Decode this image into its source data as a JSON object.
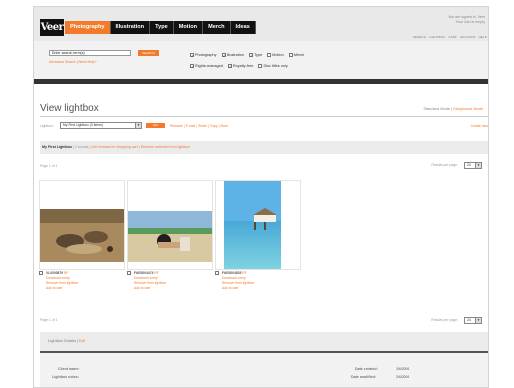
{
  "header": {
    "logo_text": "Veer",
    "tabs": [
      "Photography",
      "Illustration",
      "Type",
      "Motion",
      "Merch",
      "Ideas"
    ],
    "active_tab": "Photography",
    "signed_in": "You are signed in, Veer",
    "cart_status": "Your Cart is empty",
    "util_nav": [
      "SEARCH",
      "LIGHTBOX",
      "CART",
      "ACCOUNT",
      "HELP"
    ]
  },
  "search": {
    "value": "Enter search term(s)",
    "button": "SEARCH",
    "advanced": "Advanced Search",
    "need_help": "Need Help?",
    "filters_row1": [
      {
        "label": "Photography",
        "checked": true
      },
      {
        "label": "Illustration",
        "checked": true
      },
      {
        "label": "Type",
        "checked": true
      },
      {
        "label": "Motion",
        "checked": false
      },
      {
        "label": "Merch",
        "checked": false
      }
    ],
    "filters_row2": [
      {
        "label": "Rights-managed",
        "checked": true
      },
      {
        "label": "Royalty-free",
        "checked": true
      },
      {
        "label": "Disc titles only",
        "checked": false
      }
    ]
  },
  "page": {
    "title": "View lightbox",
    "mode_standard": "Standard Mode",
    "mode_separator": " | ",
    "mode_storyboard": "Storyboard Mode"
  },
  "lightbox": {
    "label": "Lightbox:",
    "selected": "My First Lightbox (3 items)",
    "go": "GO",
    "actions": "Rename | E-mail | Share | Copy | More",
    "create_new": "Create new"
  },
  "tabbar": {
    "name": "My First Lightbox",
    "results": "| 3 results |",
    "link1": "Get invoiced in shopping cart",
    "sep": " | ",
    "link2": "Remove selected from lightbox"
  },
  "paging": {
    "page_label": "Page 1 of 1",
    "rpp_label": "Results per page:",
    "rpp_value": "24"
  },
  "items": [
    {
      "code": "VL0000879",
      "tag": "RF",
      "links": [
        "Download comp",
        "Remove from lightbox",
        "Add to cart"
      ],
      "kind": "desert"
    },
    {
      "code": "FAR2004474",
      "tag": "RF",
      "links": [
        "Download comp",
        "Remove from lightbox",
        "Add to cart"
      ],
      "kind": "beach"
    },
    {
      "code": "FAR2004835",
      "tag": "RF",
      "links": [
        "Download comp",
        "Remove from lightbox",
        "Add to cart"
      ],
      "kind": "resort"
    }
  ],
  "details": {
    "heading": "Lightbox Details",
    "edit": "Edit",
    "client_name_label": "Client name:",
    "notes_label": "Lightbox notes:",
    "created_label": "Date created:",
    "created_value": "3/6/2006",
    "modified_label": "Date modified:",
    "modified_value": "3/6/2006"
  },
  "colors": {
    "accent": "#f27a2b",
    "navbar": "#111111"
  }
}
